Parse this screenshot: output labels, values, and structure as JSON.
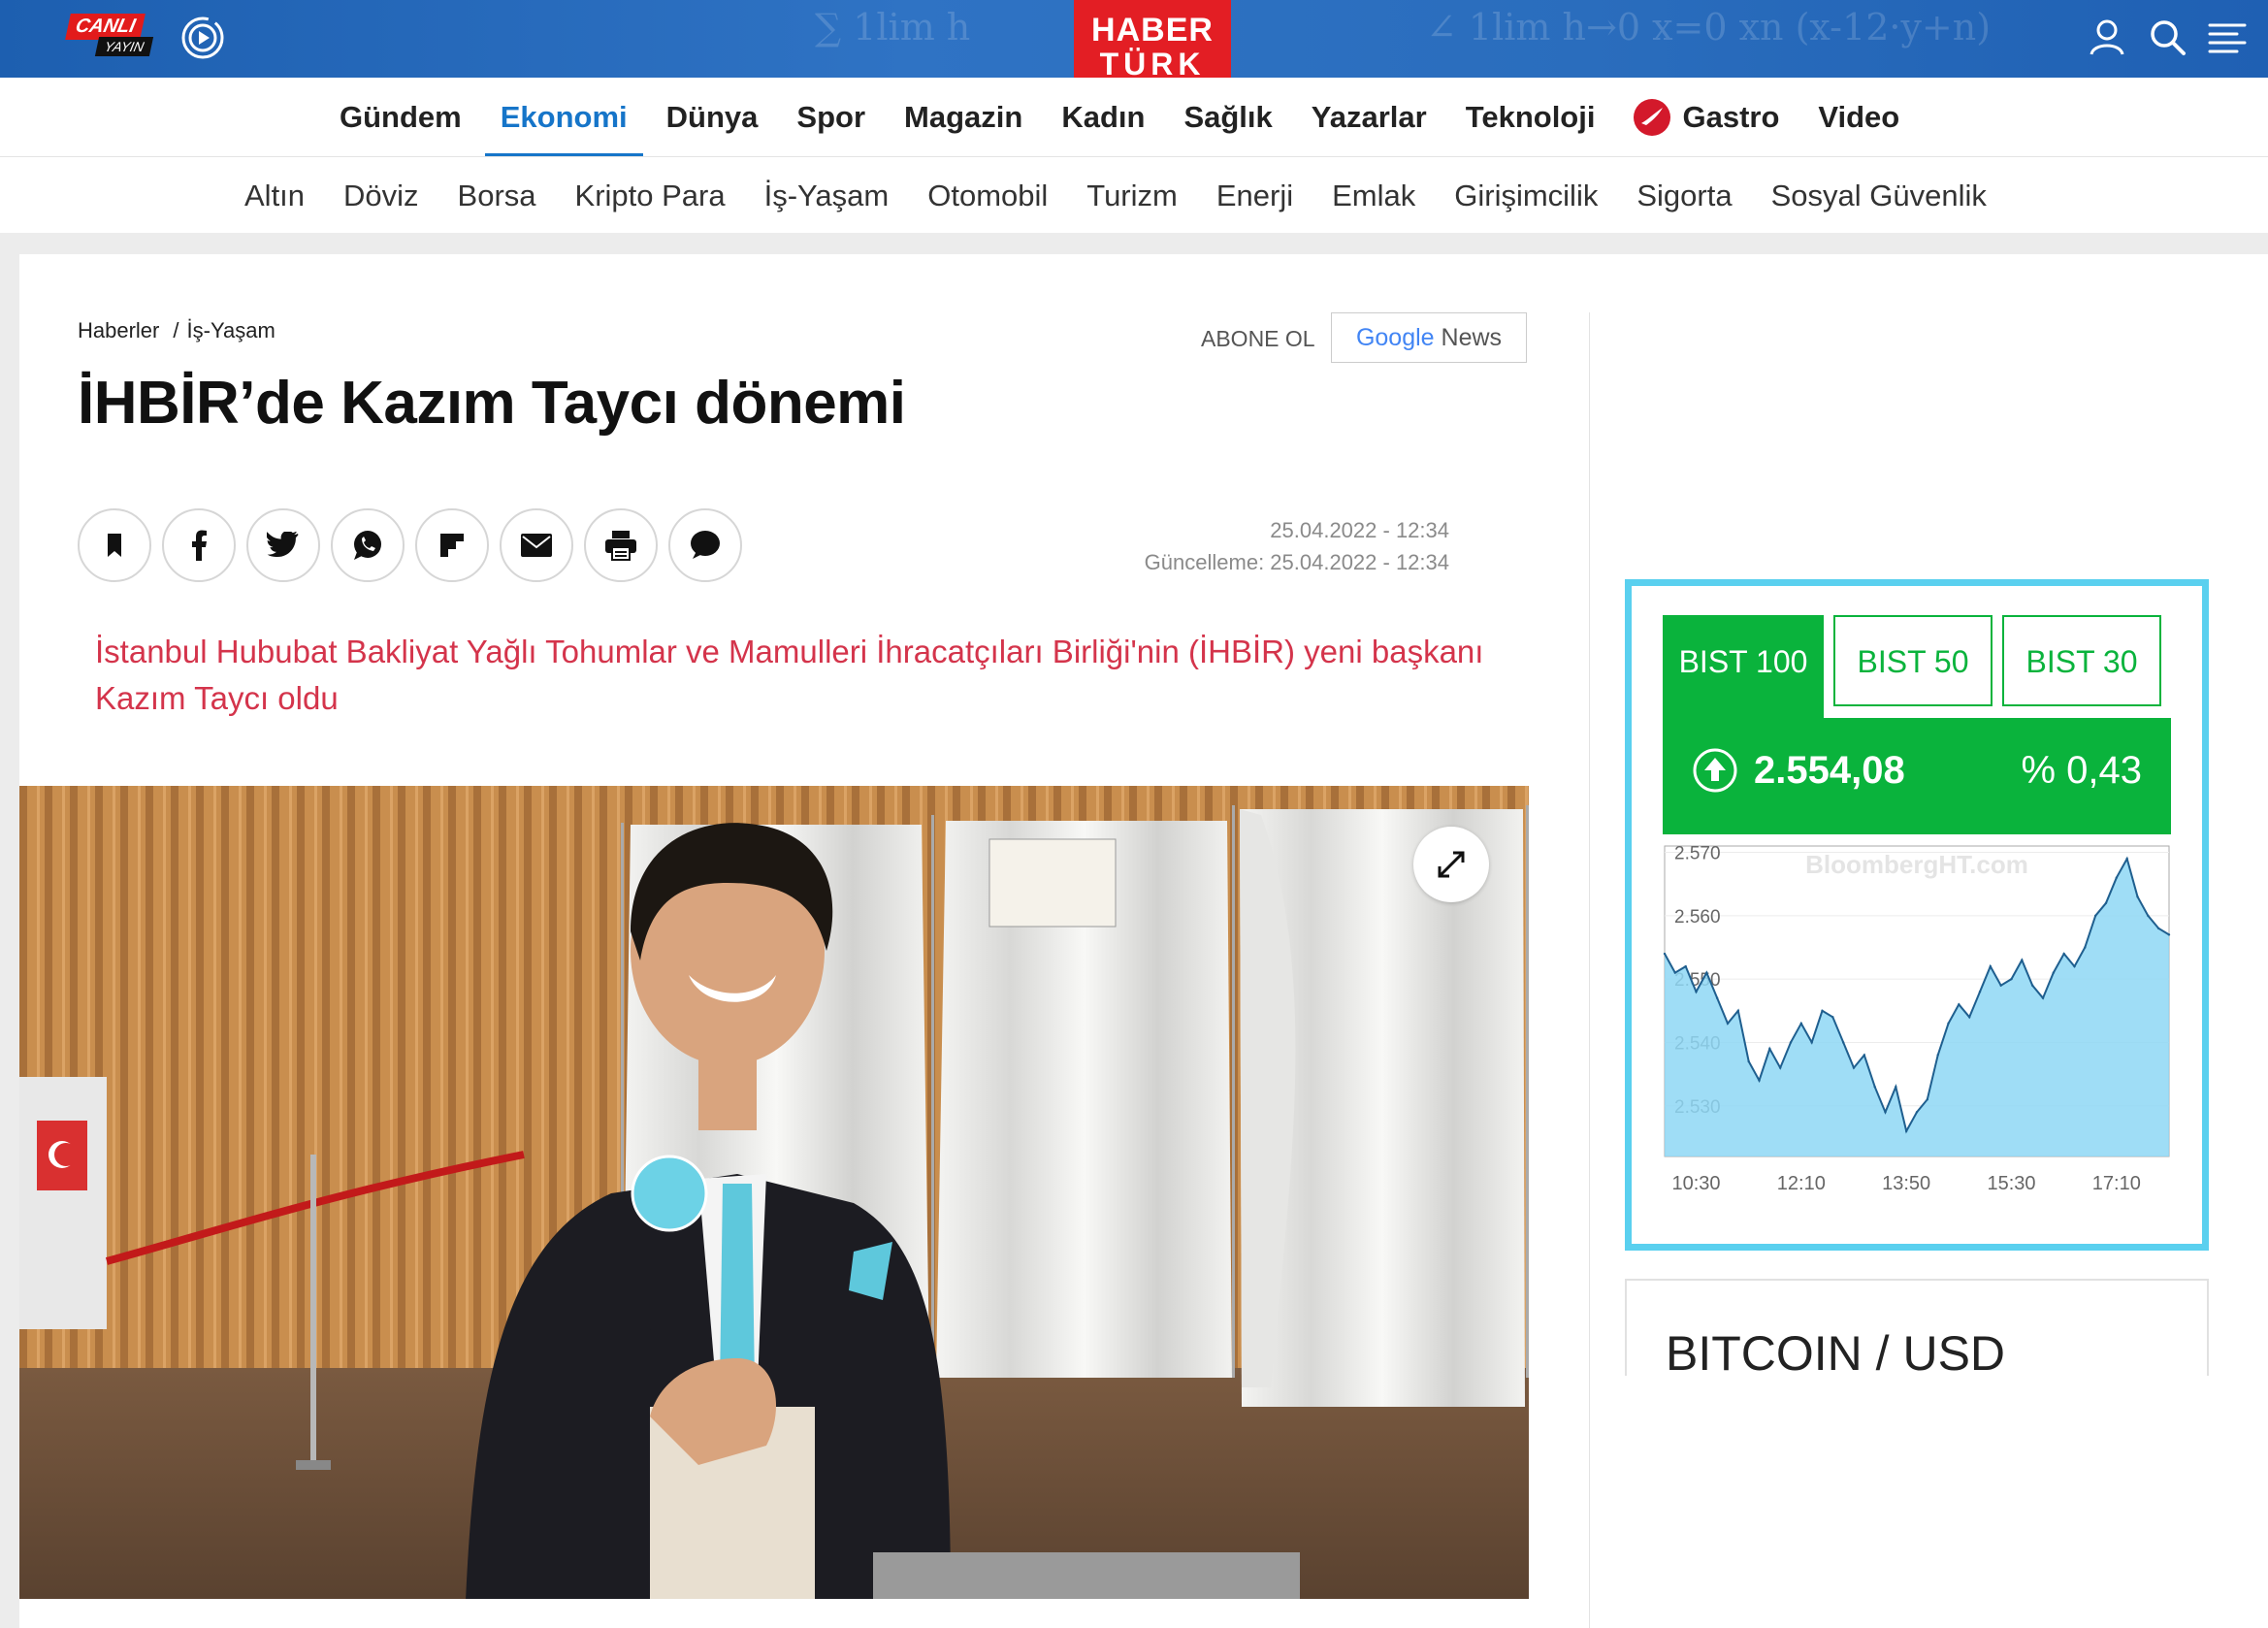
{
  "header": {
    "live_line1": "CANLI",
    "live_line2": "YAYIN",
    "logo_line1": "HABER",
    "logo_line2": "TÜRK",
    "icons": [
      "play-icon",
      "user-icon",
      "search-icon",
      "menu-icon"
    ],
    "brand_color": "#e31e24"
  },
  "nav": {
    "main": [
      "Gündem",
      "Ekonomi",
      "Dünya",
      "Spor",
      "Magazin",
      "Kadın",
      "Sağlık",
      "Yazarlar",
      "Teknoloji",
      "Gastro",
      "Video"
    ],
    "active": "Ekonomi",
    "sub": [
      "Altın",
      "Döviz",
      "Borsa",
      "Kripto Para",
      "İş-Yaşam",
      "Otomobil",
      "Turizm",
      "Enerji",
      "Emlak",
      "Girişimcilik",
      "Sigorta",
      "Sosyal Güvenlik"
    ]
  },
  "article": {
    "breadcrumb": [
      "Haberler",
      "İş-Yaşam"
    ],
    "breadcrumb_sep": "/",
    "subscribe_label": "ABONE OL",
    "gnews_google": "Google",
    "gnews_news": "News",
    "title": "İHBİR’de Kazım Taycı dönemi",
    "share_buttons": [
      "bookmark-icon",
      "facebook-icon",
      "twitter-icon",
      "whatsapp-icon",
      "flipboard-icon",
      "mail-icon",
      "print-icon",
      "comment-icon"
    ],
    "published": "25.04.2022 - 12:34",
    "updated": "Güncelleme: 25.04.2022 - 12:34",
    "spot": "İstanbul Hububat Bakliyat Yağlı Tohumlar ve Mamulleri İhracatçıları Birliği'nin (İHBİR) yeni başkanı Kazım Taycı oldu",
    "spot_color": "#d4344b"
  },
  "market_widget": {
    "tabs": [
      "BIST 100",
      "BIST 50",
      "BIST 30"
    ],
    "active_tab": "BIST 100",
    "value": "2.554,08",
    "change": "% 0,43",
    "accent": "#0ab33c",
    "watermark": "BloombergHT.com"
  },
  "chart_data": {
    "type": "area",
    "title": "",
    "xlabel": "",
    "ylabel": "",
    "x_ticks": [
      "10:30",
      "12:10",
      "13:50",
      "15:30",
      "17:10"
    ],
    "y_ticks": [
      "2.570",
      "2.560",
      "2.550",
      "2.540",
      "2.530"
    ],
    "ylim": [
      2522,
      2571
    ],
    "x": [
      "10:00",
      "10:10",
      "10:20",
      "10:30",
      "10:40",
      "10:50",
      "11:00",
      "11:10",
      "11:20",
      "11:30",
      "11:40",
      "11:50",
      "12:00",
      "12:10",
      "12:20",
      "12:30",
      "12:40",
      "12:50",
      "13:00",
      "13:10",
      "13:20",
      "13:30",
      "13:40",
      "13:50",
      "14:00",
      "14:10",
      "14:20",
      "14:30",
      "14:40",
      "14:50",
      "15:00",
      "15:10",
      "15:20",
      "15:30",
      "15:40",
      "15:50",
      "16:00",
      "16:10",
      "16:20",
      "16:30",
      "16:40",
      "16:50",
      "17:00",
      "17:10",
      "17:20",
      "17:30",
      "17:40",
      "17:50",
      "18:00"
    ],
    "values": [
      2554,
      2551,
      2552,
      2548,
      2551,
      2547,
      2543,
      2545,
      2537,
      2534,
      2539,
      2536,
      2540,
      2543,
      2540,
      2545,
      2544,
      2540,
      2536,
      2538,
      2533,
      2529,
      2533,
      2526,
      2529,
      2531,
      2538,
      2543,
      2546,
      2544,
      2548,
      2552,
      2549,
      2550,
      2553,
      2549,
      2547,
      2551,
      2554,
      2552,
      2555,
      2560,
      2562,
      2566,
      2569,
      2563,
      2560,
      2558,
      2557
    ],
    "grid": true
  },
  "bitcoin_widget": {
    "title": "BITCOIN / USD"
  }
}
